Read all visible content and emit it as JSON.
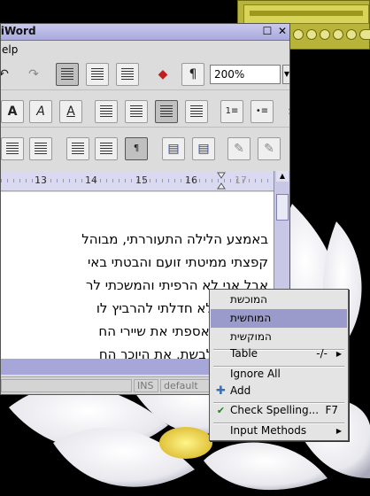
{
  "window": {
    "title": "AbiWord",
    "menu_help": "Help",
    "zoom_value": "200%"
  },
  "ruler": {
    "ticks": [
      "13",
      "14",
      "15",
      "16",
      "17"
    ]
  },
  "document": {
    "lines": [
      "באמצע הלילה התעוררתי, מבוהל",
      "קפצתי ממיטתי זועם והבטתי באי",
      "אבל אני לא הרפיתי והמשכתי לר",
      "המוכשת, לא חדלתי להרביץ לו",
      "ותש ומזיע אספתי את שיירי הח",
      "שחורים שלבשת, את היוכך הח"
    ],
    "squiggle_word": "המוכשת"
  },
  "statusbar": {
    "mode": "INS",
    "style": "default"
  },
  "context_menu": {
    "suggestions": [
      "המוכשת",
      "המוחשית",
      "המוקשית"
    ],
    "table_label": "Table",
    "table_accel": "-/-",
    "ignore_all": "Ignore All",
    "add": "Add",
    "check_spelling": "Check Spelling...",
    "check_spelling_accel": "F7",
    "input_methods": "Input Methods"
  },
  "colors": {
    "menu_highlight": "#9a9acb",
    "titlebar": "#b4b4e4",
    "ruler": "#d9d9f0",
    "player": "#b8b43a"
  }
}
